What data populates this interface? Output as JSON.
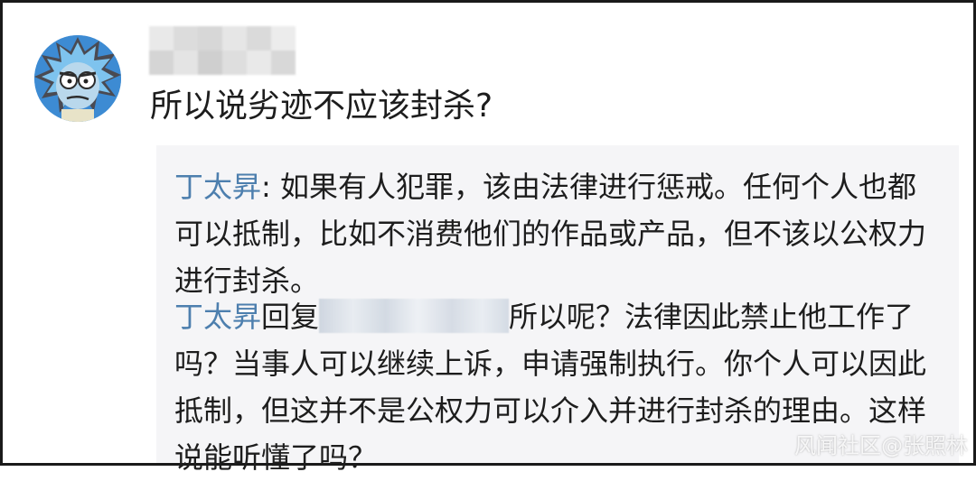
{
  "comment": {
    "text": "所以说劣迹不应该封杀?"
  },
  "replies": [
    {
      "author": "丁太昇",
      "separator": ": ",
      "text": "如果有人犯罪，该由法律进行惩戒。任何个人也都可以抵制，比如不消费他们的作品或产品，但不该以公权力进行封杀。"
    },
    {
      "author": "丁太昇",
      "reply_word": "回复",
      "text": "所以呢？法律因此禁止他工作了吗？当事人可以继续上诉，申请强制执行。你个人可以因此抵制，但这并不是公权力可以介入并进行封杀的理由。这样说能听懂了吗？"
    }
  ],
  "watermark": "风闻社区@张照林"
}
